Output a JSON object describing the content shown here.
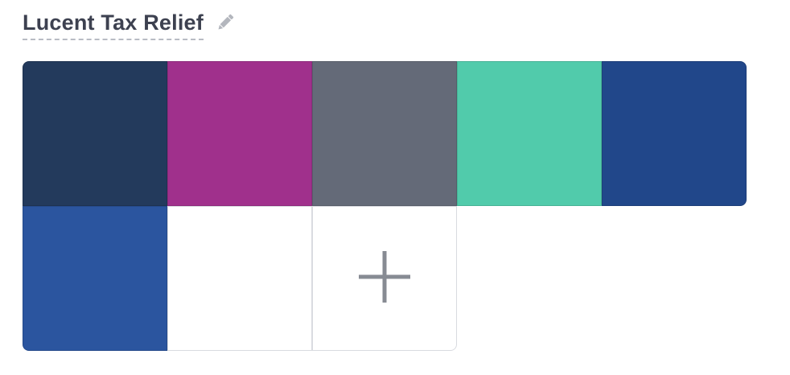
{
  "palette": {
    "title": "Lucent Tax Relief",
    "edit_icon": "pencil-icon",
    "add_icon": "plus-icon",
    "colors": [
      "#233a5c",
      "#a0308c",
      "#646a78",
      "#51cbab",
      "#21478a",
      "#2b559f",
      "#ffffff"
    ]
  }
}
